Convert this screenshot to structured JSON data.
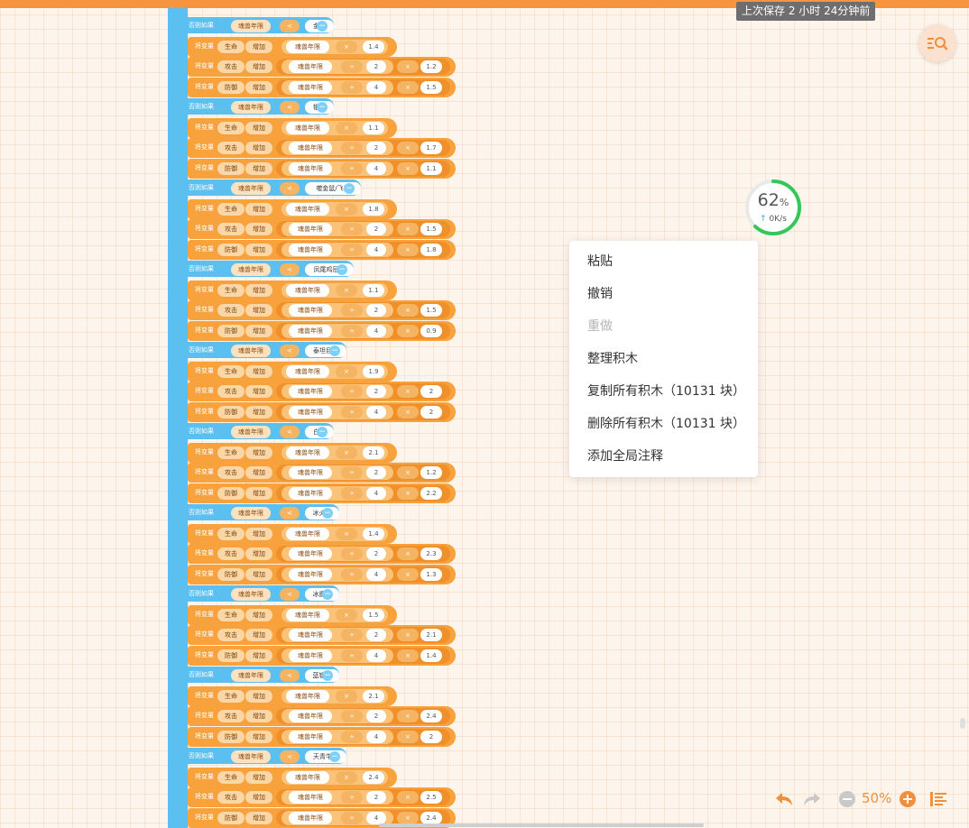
{
  "save_status": "上次保存 2 小时 24分钟前",
  "accent_color": "#f7943f",
  "block_colors": {
    "control": "#5bc0f0",
    "variable": "#f7a23c"
  },
  "script": {
    "if_keyword": "否则如果",
    "set_keyword": "将变量",
    "change_keyword": "增加",
    "age_var": "魂兽年限",
    "less_than": "<",
    "times": "×",
    "divide": "÷",
    "stats": [
      "生命",
      "攻击",
      "防御"
    ],
    "groups": [
      {
        "name": "金狮",
        "life": "1.4",
        "div_attack": "2",
        "attack": "1.2",
        "div_defense": "4",
        "defense": "1.5"
      },
      {
        "name": "银狼",
        "life": "1.1",
        "div_attack": "2",
        "attack": "1.7",
        "div_defense": "4",
        "defense": "1.1"
      },
      {
        "name": "噬金鼠/飞鼠",
        "life": "1.8",
        "div_attack": "2",
        "attack": "1.5",
        "div_defense": "4",
        "defense": "1.8"
      },
      {
        "name": "凤尾鸡冠蛇",
        "life": "1.1",
        "div_attack": "2",
        "attack": "1.5",
        "div_defense": "4",
        "defense": "0.9"
      },
      {
        "name": "泰坦巨猿",
        "life": "1.9",
        "div_attack": "2",
        "attack": "2",
        "div_defense": "4",
        "defense": "2"
      },
      {
        "name": "白虎",
        "life": "2.1",
        "div_attack": "2",
        "attack": "1.2",
        "div_defense": "4",
        "defense": "2.2"
      },
      {
        "name": "冰火龙",
        "life": "1.4",
        "div_attack": "2",
        "attack": "2.3",
        "div_defense": "4",
        "defense": "1.3"
      },
      {
        "name": "冰魔龙",
        "life": "1.5",
        "div_attack": "2",
        "attack": "2.1",
        "div_defense": "4",
        "defense": "1.4"
      },
      {
        "name": "蓝银皇",
        "life": "2.1",
        "div_attack": "2",
        "attack": "2.4",
        "div_defense": "4",
        "defense": "2"
      },
      {
        "name": "天青牛蟒",
        "life": "2.4",
        "div_attack": "2",
        "attack": "2.5",
        "div_defense": "4",
        "defense": "2.4"
      }
    ]
  },
  "net_status": {
    "percent": "62",
    "percent_sign": "%",
    "progress": 0.62,
    "speed": "0K/s",
    "ring_color": "#34c759"
  },
  "context_menu": {
    "items": [
      {
        "label": "粘贴",
        "disabled": false
      },
      {
        "label": "撤销",
        "disabled": false
      },
      {
        "label": "重做",
        "disabled": true
      },
      {
        "label": "整理积木",
        "disabled": false
      },
      {
        "label": "复制所有积木（10131 块）",
        "disabled": false
      },
      {
        "label": "删除所有积木（10131 块）",
        "disabled": false
      },
      {
        "label": "添加全局注释",
        "disabled": false
      }
    ]
  },
  "toolbar": {
    "undo_icon": "undo-icon",
    "redo_icon": "redo-icon",
    "zoom_out_icon": "zoom-out-icon",
    "zoom_in_icon": "zoom-in-icon",
    "zoom_level": "50%",
    "arrange_icon": "arrange-icon"
  }
}
